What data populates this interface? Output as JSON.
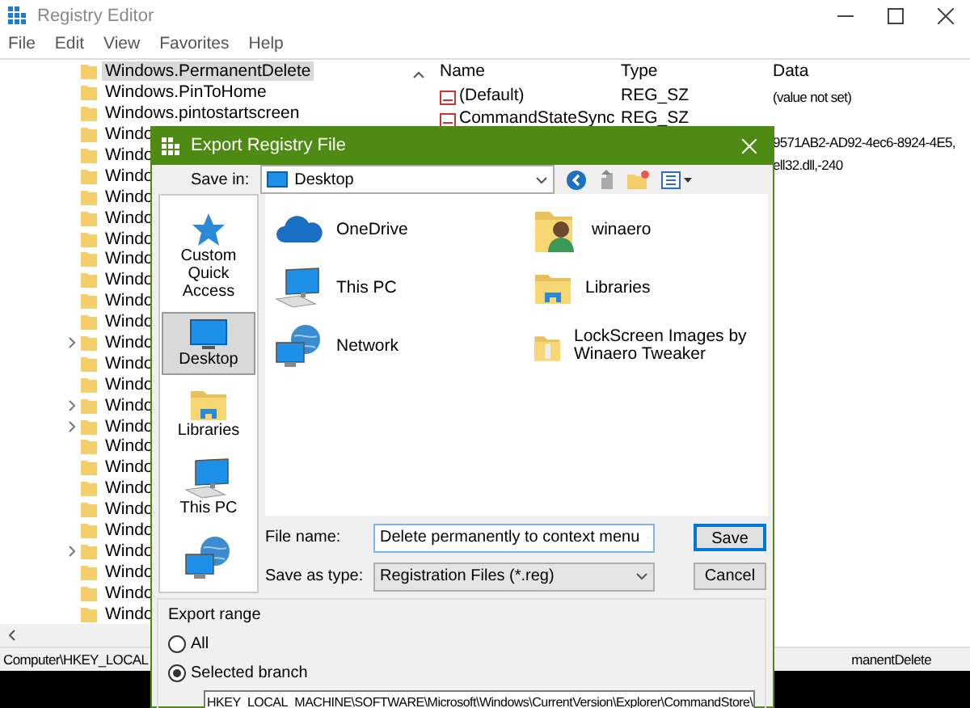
{
  "window": {
    "title": "Registry Editor"
  },
  "menu": [
    "File",
    "Edit",
    "View",
    "Favorites",
    "Help"
  ],
  "tree": [
    {
      "label": "Windows.PermanentDelete",
      "selected": true,
      "expandable": false
    },
    {
      "label": "Windows.PinToHome",
      "selected": false,
      "expandable": false
    },
    {
      "label": "Windows.pintostartscreen",
      "selected": false,
      "expandable": false
    },
    {
      "label": "Windo",
      "selected": false,
      "expandable": false
    },
    {
      "label": "Windo",
      "selected": false,
      "expandable": false
    },
    {
      "label": "Windo",
      "selected": false,
      "expandable": false
    },
    {
      "label": "Windo",
      "selected": false,
      "expandable": false
    },
    {
      "label": "Windo",
      "selected": false,
      "expandable": false
    },
    {
      "label": "Windo",
      "selected": false,
      "expandable": false
    },
    {
      "label": "Windo",
      "selected": false,
      "expandable": false
    },
    {
      "label": "Windo",
      "selected": false,
      "expandable": false
    },
    {
      "label": "Windo",
      "selected": false,
      "expandable": false
    },
    {
      "label": "Windo",
      "selected": false,
      "expandable": false
    },
    {
      "label": "Windo",
      "selected": false,
      "expandable": true
    },
    {
      "label": "Windo",
      "selected": false,
      "expandable": false
    },
    {
      "label": "Windo",
      "selected": false,
      "expandable": false
    },
    {
      "label": "Windo",
      "selected": false,
      "expandable": true
    },
    {
      "label": "Windo",
      "selected": false,
      "expandable": true
    },
    {
      "label": "Windo",
      "selected": false,
      "expandable": false
    },
    {
      "label": "Windo",
      "selected": false,
      "expandable": false
    },
    {
      "label": "Windo",
      "selected": false,
      "expandable": false
    },
    {
      "label": "Windo",
      "selected": false,
      "expandable": false
    },
    {
      "label": "Windo",
      "selected": false,
      "expandable": false
    },
    {
      "label": "Windo",
      "selected": false,
      "expandable": true
    },
    {
      "label": "Windo",
      "selected": false,
      "expandable": false
    },
    {
      "label": "Windo",
      "selected": false,
      "expandable": false
    },
    {
      "label": "Windo",
      "selected": false,
      "expandable": false
    }
  ],
  "values": {
    "columns": [
      "Name",
      "Type",
      "Data"
    ],
    "rows": [
      {
        "name": "(Default)",
        "type": "REG_SZ",
        "data": "(value not set)"
      },
      {
        "name": "CommandStateSync",
        "type": "REG_SZ"
      },
      {
        "data": "9571AB2-AD92-4ec6-8924-4E5,"
      },
      {
        "data": "ell32.dll,-240"
      }
    ]
  },
  "status_bar": {
    "left": "Computer\\HKEY_LOCAL",
    "right": "manentDelete"
  },
  "dialog": {
    "title": "Export Registry File",
    "save_in": {
      "label": "Save in:",
      "value": "Desktop"
    },
    "places": [
      {
        "kind": "quickaccess",
        "label": "Custom Quick Access",
        "selected": false
      },
      {
        "kind": "desktop",
        "label": "Desktop",
        "selected": true
      },
      {
        "kind": "libraries",
        "label": "Libraries",
        "selected": false
      },
      {
        "kind": "computer",
        "label": "This PC",
        "selected": false
      },
      {
        "kind": "network",
        "selected": false
      }
    ],
    "items": [
      {
        "kind": "cloud",
        "label": "OneDrive"
      },
      {
        "kind": "computer",
        "label": "This PC"
      },
      {
        "kind": "network",
        "label": "Network"
      },
      {
        "kind": "userfolder",
        "label": "winaero"
      },
      {
        "kind": "libraries",
        "label": "Libraries"
      },
      {
        "kind": "folder",
        "label": "LockScreen Images by Winaero Tweaker"
      }
    ],
    "file_name": {
      "label": "File name:",
      "value": "Delete permanently to context menu"
    },
    "save_as_type": {
      "label": "Save as type:",
      "value": "Registration Files (*.reg)"
    },
    "buttons": [
      "Save",
      "Cancel"
    ],
    "export_range": {
      "title": "Export range",
      "options": [
        {
          "label": "All",
          "selected": false
        },
        {
          "label": "Selected branch",
          "selected": true
        }
      ],
      "branch": "HKEY_LOCAL_MACHINE\\SOFTWARE\\Microsoft\\Windows\\CurrentVersion\\Explorer\\CommandStore\\"
    }
  }
}
